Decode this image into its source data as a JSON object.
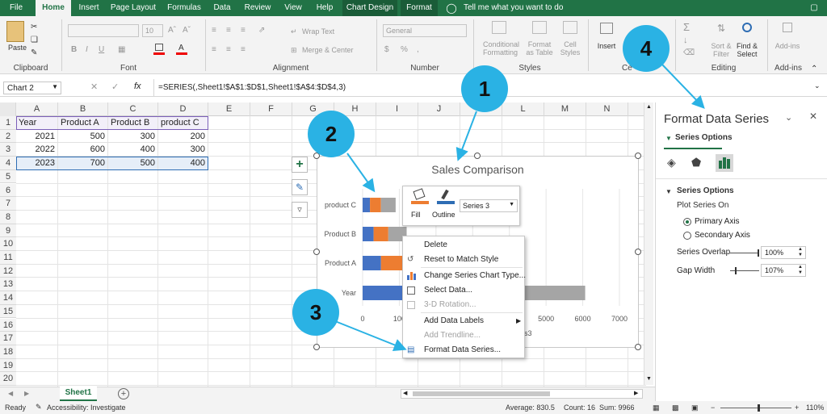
{
  "ribbon_tabs": [
    "File",
    "Home",
    "Insert",
    "Page Layout",
    "Formulas",
    "Data",
    "Review",
    "View",
    "Help",
    "Chart Design",
    "Format"
  ],
  "tell_me": "Tell me what you want to do",
  "ribbon": {
    "paste": "Paste",
    "clipboard": "Clipboard",
    "font": "Font",
    "font_size": "10",
    "wrap_text": "Wrap Text",
    "merge_center": "Merge & Center",
    "alignment": "Alignment",
    "number_format": "General",
    "number": "Number",
    "conditional_formatting": "Conditional Formatting",
    "format_as_table": "Format as Table",
    "cell_styles": "Cell Styles",
    "styles": "Styles",
    "insert": "Insert",
    "cells": "Ce",
    "sort_filter": "Sort & Filter",
    "find_select": "Find & Select",
    "editing": "Editing",
    "addins": "Add-ins",
    "addins_group": "Add-ins"
  },
  "name_box": "Chart 2",
  "fx": "fx",
  "formula": "=SERIES(,Sheet1!$A$1:$D$1,Sheet1!$A$4:$D$4,3)",
  "columns": [
    "A",
    "B",
    "C",
    "D",
    "E",
    "F",
    "G",
    "H",
    "I",
    "J",
    "K",
    "L",
    "M",
    "N"
  ],
  "rows": [
    "1",
    "2",
    "3",
    "4",
    "5",
    "6",
    "7",
    "8",
    "9",
    "10",
    "11",
    "12",
    "13",
    "14",
    "15",
    "16",
    "17",
    "18",
    "19",
    "20"
  ],
  "sheet": [
    [
      "Year",
      "Product A",
      "Product B",
      "product C"
    ],
    [
      "2021",
      "500",
      "300",
      "200"
    ],
    [
      "2022",
      "600",
      "400",
      "300"
    ],
    [
      "2023",
      "700",
      "500",
      "400"
    ]
  ],
  "chart_data": {
    "type": "bar",
    "title": "Sales Comparison",
    "categories": [
      "Year",
      "Product A",
      "Product B",
      "product C"
    ],
    "series": [
      {
        "values": [
          2021,
          500,
          300,
          200
        ],
        "color": "#4472c4"
      },
      {
        "values": [
          2022,
          600,
          400,
          300
        ],
        "color": "#ed7d31"
      },
      {
        "values": [
          2023,
          700,
          500,
          400
        ],
        "color": "#a5a5a5"
      }
    ],
    "xticks": [
      "0",
      "100",
      "5000",
      "6000",
      "7000"
    ],
    "xlim": [
      0,
      7000
    ]
  },
  "mini_toolbar": {
    "fill": "Fill",
    "outline": "Outline",
    "series_select": "Series 3"
  },
  "context_menu": [
    {
      "label": "Delete",
      "disabled": false
    },
    {
      "label": "Reset to Match Style",
      "disabled": false
    },
    {
      "label": "Change Series Chart Type...",
      "disabled": false
    },
    {
      "label": "Select Data...",
      "disabled": false
    },
    {
      "label": "3-D Rotation...",
      "disabled": true
    },
    {
      "label": "Add Data Labels",
      "disabled": false
    },
    {
      "label": "Add Trendline...",
      "disabled": true
    },
    {
      "label": "Format Data Series...",
      "disabled": false
    }
  ],
  "chart_side_fragment": "s3",
  "format_pane": {
    "title": "Format Data Series",
    "series_options_tab": "Series Options",
    "section": "Series Options",
    "plot_on": "Plot Series On",
    "primary": "Primary Axis",
    "secondary": "Secondary Axis",
    "overlap_label": "Series Overlap",
    "overlap_value": "100%",
    "gap_label": "Gap Width",
    "gap_value": "107%"
  },
  "callouts": [
    "1",
    "2",
    "3",
    "4"
  ],
  "sheet_tab": "Sheet1",
  "status": {
    "ready": "Ready",
    "accessibility": "Accessibility: Investigate",
    "average": "Average: 830.5",
    "count": "Count: 16",
    "sum": "Sum: 9966",
    "zoom": "110%"
  },
  "colors": {
    "excel_green": "#217346",
    "callout": "#2ab2e4",
    "series1": "#4472c4",
    "series2": "#ed7d31",
    "series3": "#a5a5a5"
  }
}
